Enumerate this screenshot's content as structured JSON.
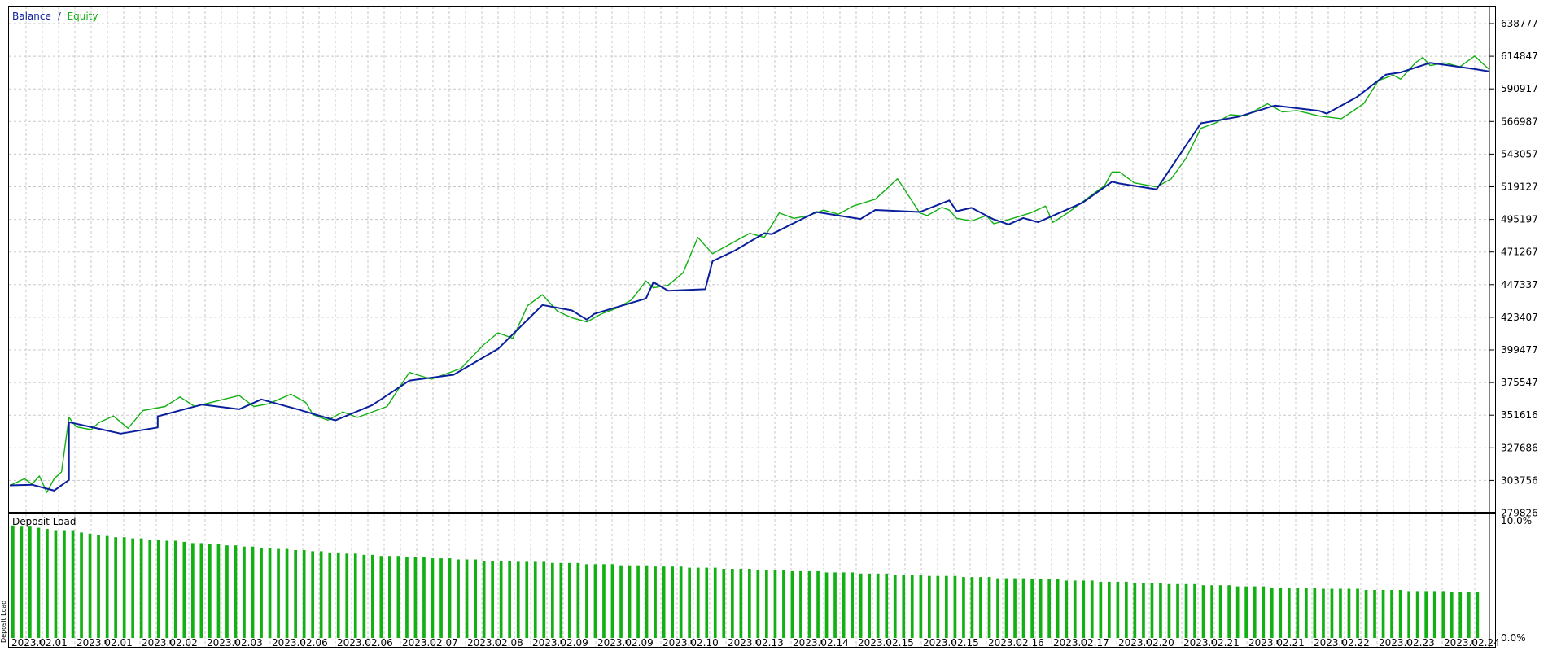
{
  "legend": {
    "balance_label": "Balance",
    "separator": "/",
    "equity_label": "Equity"
  },
  "lower_panel": {
    "title": "Deposit Load",
    "side_label": "Deposit Load"
  },
  "colors": {
    "balance": "#0a1f9c",
    "equity": "#13b013",
    "deposit_bar": "#13b013",
    "grid": "#c8c8c8",
    "border": "#000000",
    "text": "#000000"
  },
  "chart_data": [
    {
      "type": "line",
      "panel": "upper",
      "title": "",
      "xlabel": "",
      "ylabel": "",
      "grid": true,
      "legend_position": "top-left",
      "x_tick_labels": [
        "2023.02.01",
        "2023.02.01",
        "2023.02.02",
        "2023.02.03",
        "2023.02.06",
        "2023.02.06",
        "2023.02.07",
        "2023.02.08",
        "2023.02.09",
        "2023.02.09",
        "2023.02.10",
        "2023.02.13",
        "2023.02.14",
        "2023.02.15",
        "2023.02.15",
        "2023.02.16",
        "2023.02.17",
        "2023.02.20",
        "2023.02.21",
        "2023.02.21",
        "2023.02.22",
        "2023.02.23",
        "2023.02.24"
      ],
      "y_tick_labels": [
        "638777",
        "614847",
        "590917",
        "566987",
        "543057",
        "519127",
        "495197",
        "471267",
        "447337",
        "423407",
        "399477",
        "375547",
        "351616",
        "327686",
        "303756",
        "279826"
      ],
      "ylim": [
        279826,
        645000
      ],
      "x_range": [
        0,
        200
      ],
      "series": [
        {
          "name": "Balance",
          "x": [
            0,
            3,
            6,
            8,
            8,
            15,
            20,
            20,
            26,
            31,
            34,
            39,
            44,
            49,
            54,
            60,
            66,
            72,
            76,
            78,
            79,
            86,
            87,
            89,
            94,
            95,
            98,
            102,
            103,
            109,
            115,
            117,
            123,
            127,
            128,
            130,
            133,
            135,
            137,
            139,
            145,
            149,
            150,
            155,
            161,
            166,
            171,
            177,
            178,
            182,
            186,
            188,
            192,
            198,
            200
          ],
          "y": [
            300100,
            300600,
            296300,
            304100,
            346500,
            338100,
            342600,
            350800,
            359400,
            356000,
            363200,
            355800,
            347800,
            359000,
            377000,
            381300,
            400200,
            432400,
            428400,
            421700,
            425900,
            437200,
            449100,
            442900,
            444000,
            464600,
            472300,
            485100,
            484400,
            500600,
            495500,
            502100,
            500600,
            509100,
            501200,
            503700,
            495200,
            491500,
            496200,
            493100,
            507400,
            522800,
            521500,
            517200,
            565700,
            570300,
            578700,
            574800,
            572800,
            584600,
            601300,
            603000,
            610000,
            605400,
            603600
          ]
        },
        {
          "name": "Equity",
          "x": [
            0,
            2,
            3,
            4,
            5,
            6,
            7,
            8,
            9,
            11,
            12,
            14,
            16,
            18,
            21,
            23,
            25,
            28,
            31,
            33,
            35,
            38,
            40,
            41,
            43,
            45,
            47,
            48,
            51,
            54,
            57,
            61,
            64,
            66,
            68,
            70,
            72,
            74,
            76,
            78,
            80,
            82,
            84,
            86,
            87,
            89,
            91,
            93,
            95,
            97,
            100,
            102,
            104,
            106,
            108,
            110,
            112,
            114,
            117,
            120,
            123,
            124,
            126,
            127,
            128,
            130,
            132,
            133,
            135,
            138,
            140,
            141,
            143,
            146,
            148,
            149,
            150,
            152,
            155,
            157,
            159,
            161,
            163,
            165,
            167,
            170,
            172,
            174,
            177,
            180,
            183,
            185,
            187,
            188,
            190,
            191,
            192,
            194,
            196,
            198,
            200
          ],
          "y": [
            300000,
            305000,
            301000,
            307000,
            295000,
            305000,
            310000,
            350000,
            343000,
            341000,
            346000,
            351000,
            342000,
            355000,
            358000,
            365000,
            358000,
            362000,
            366000,
            358000,
            360000,
            367000,
            361000,
            352000,
            348000,
            354000,
            350000,
            352000,
            358000,
            383000,
            378000,
            386000,
            403000,
            412000,
            408000,
            432000,
            440000,
            428000,
            423000,
            420000,
            426000,
            430000,
            436000,
            450000,
            445000,
            447000,
            456000,
            482000,
            470000,
            476000,
            485000,
            482000,
            500000,
            496000,
            498000,
            502000,
            499000,
            505000,
            510000,
            525000,
            500000,
            498000,
            504000,
            502000,
            496000,
            494000,
            498000,
            492000,
            495000,
            500000,
            505000,
            493000,
            500000,
            512000,
            520000,
            530000,
            530000,
            522000,
            519000,
            525000,
            540000,
            562000,
            566000,
            572000,
            571000,
            580000,
            574000,
            575000,
            571000,
            569000,
            580000,
            597000,
            601000,
            598000,
            610000,
            614000,
            608000,
            610000,
            607000,
            615000,
            605000
          ]
        }
      ]
    },
    {
      "type": "bar",
      "panel": "lower",
      "title": "Deposit Load",
      "xlabel": "",
      "ylabel": "",
      "y_tick_labels": [
        "10.0%",
        "0.0%"
      ],
      "ylim": [
        0,
        10.0
      ],
      "series": [
        {
          "name": "Deposit Load",
          "values": [
            9.6,
            9.5,
            9.5,
            9.4,
            9.3,
            9.2,
            9.2,
            9.2,
            9.0,
            8.9,
            8.8,
            8.7,
            8.6,
            8.6,
            8.5,
            8.5,
            8.4,
            8.4,
            8.3,
            8.3,
            8.2,
            8.1,
            8.1,
            8.0,
            8.0,
            7.9,
            7.9,
            7.8,
            7.8,
            7.7,
            7.7,
            7.6,
            7.6,
            7.5,
            7.5,
            7.4,
            7.4,
            7.3,
            7.3,
            7.2,
            7.2,
            7.1,
            7.1,
            7.0,
            7.0,
            7.0,
            6.9,
            6.9,
            6.9,
            6.8,
            6.8,
            6.8,
            6.7,
            6.7,
            6.7,
            6.6,
            6.6,
            6.6,
            6.6,
            6.5,
            6.5,
            6.5,
            6.5,
            6.4,
            6.4,
            6.4,
            6.4,
            6.3,
            6.3,
            6.3,
            6.3,
            6.2,
            6.2,
            6.2,
            6.2,
            6.1,
            6.1,
            6.1,
            6.1,
            6.0,
            6.0,
            6.0,
            6.0,
            5.9,
            5.9,
            5.9,
            5.9,
            5.8,
            5.8,
            5.8,
            5.8,
            5.7,
            5.7,
            5.7,
            5.7,
            5.6,
            5.6,
            5.6,
            5.6,
            5.5,
            5.5,
            5.5,
            5.5,
            5.4,
            5.4,
            5.4,
            5.4,
            5.3,
            5.3,
            5.3,
            5.3,
            5.2,
            5.2,
            5.2,
            5.2,
            5.1,
            5.1,
            5.1,
            5.1,
            5.0,
            5.0,
            5.0,
            5.0,
            4.9,
            4.9,
            4.9,
            4.9,
            4.8,
            4.8,
            4.8,
            4.8,
            4.7,
            4.7,
            4.7,
            4.7,
            4.6,
            4.6,
            4.6,
            4.6,
            4.5,
            4.5,
            4.5,
            4.5,
            4.4,
            4.4,
            4.4,
            4.4,
            4.3,
            4.3,
            4.3,
            4.3,
            4.3,
            4.3,
            4.2,
            4.2,
            4.2,
            4.2,
            4.2,
            4.1,
            4.1,
            4.1,
            4.1,
            4.1,
            4.0,
            4.0,
            4.0,
            4.0,
            4.0,
            3.9,
            3.9,
            3.9,
            3.9
          ]
        }
      ]
    }
  ]
}
